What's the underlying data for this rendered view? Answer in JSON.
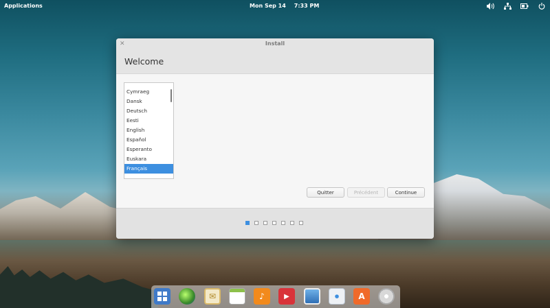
{
  "top_panel": {
    "applications_label": "Applications",
    "date": "Mon Sep 14",
    "time": "7:33 PM",
    "tray_icons": [
      "volume-icon",
      "network-icon",
      "battery-icon",
      "power-icon"
    ]
  },
  "window": {
    "title": "Install",
    "heading": "Welcome",
    "language_list": {
      "items": [
        "Cymraeg",
        "Dansk",
        "Deutsch",
        "Eesti",
        "English",
        "Español",
        "Esperanto",
        "Euskara",
        "Français"
      ],
      "selected": "Français"
    },
    "buttons": {
      "quit": "Quitter",
      "previous": "Précédent",
      "continue": "Continue"
    },
    "progress": {
      "total_steps": 7,
      "current_step": 1
    }
  },
  "dock": {
    "items": [
      "multitasking-view",
      "web-browser",
      "mail",
      "calendar",
      "music",
      "videos",
      "photos",
      "system-settings",
      "app-center",
      "installer"
    ]
  },
  "colors": {
    "accent": "#3d8fe0",
    "titlebar": "#e4e4e4"
  }
}
